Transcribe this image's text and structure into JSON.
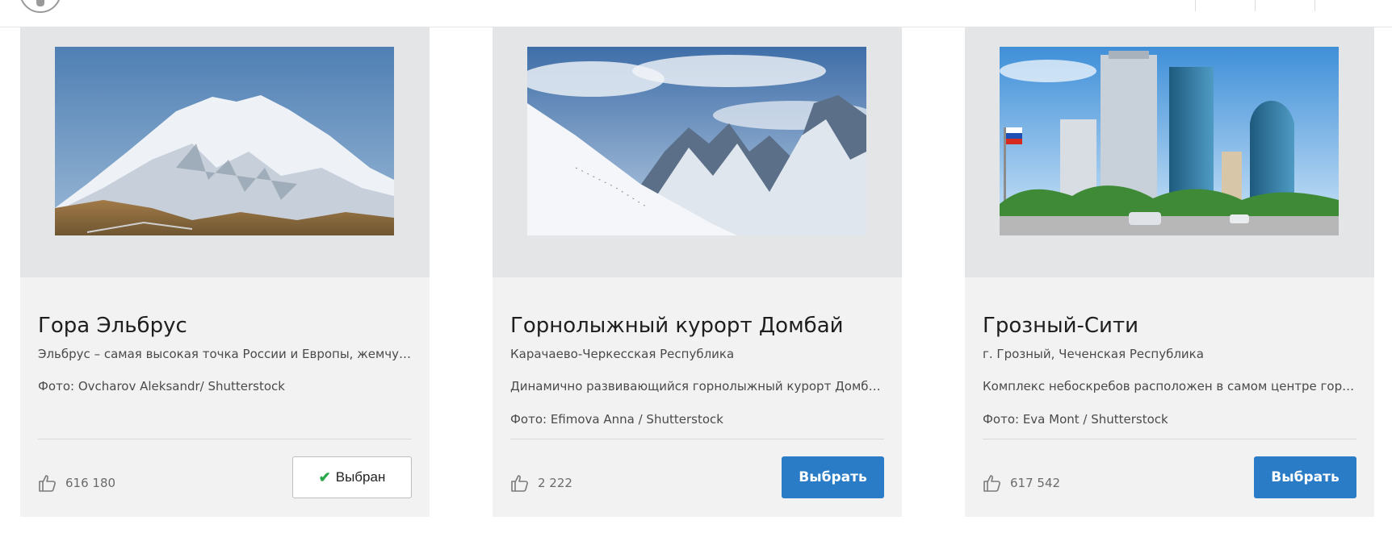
{
  "cards": [
    {
      "title": "Гора Эльбрус",
      "subtitle": "Эльбрус – самая высокая точка России и Европы, жемчужина Кавказа",
      "line2": "Фото: Ovcharov Aleksandr/ Shutterstock",
      "line3": "",
      "likes": "616 180",
      "button_label": "Выбран",
      "selected": true
    },
    {
      "title": "Горнолыжный курорт Домбай",
      "subtitle": "Карачаево-Черкесская Республика",
      "line2": "Динамично развивающийся горнолыжный курорт Домбай расположен в горах",
      "line3": "Фото: Efimova Anna / Shutterstock",
      "likes": "2 222",
      "button_label": "Выбрать",
      "selected": false
    },
    {
      "title": "Грозный-Сити",
      "subtitle": "г. Грозный, Чеченская Республика",
      "line2": "Комплекс небоскребов расположен в самом центре города Грозного",
      "line3": "Фото: Eva Mont / Shutterstock",
      "likes": "617 542",
      "button_label": "Выбрать",
      "selected": false
    }
  ],
  "icons": {
    "like": "thumbs-up-icon",
    "check": "check-icon",
    "avatar": "user-avatar-icon"
  },
  "colors": {
    "primary_button": "#2a7cc7",
    "check": "#2aa84a",
    "card_bg": "#f2f2f2",
    "media_bg": "#e4e5e7"
  }
}
